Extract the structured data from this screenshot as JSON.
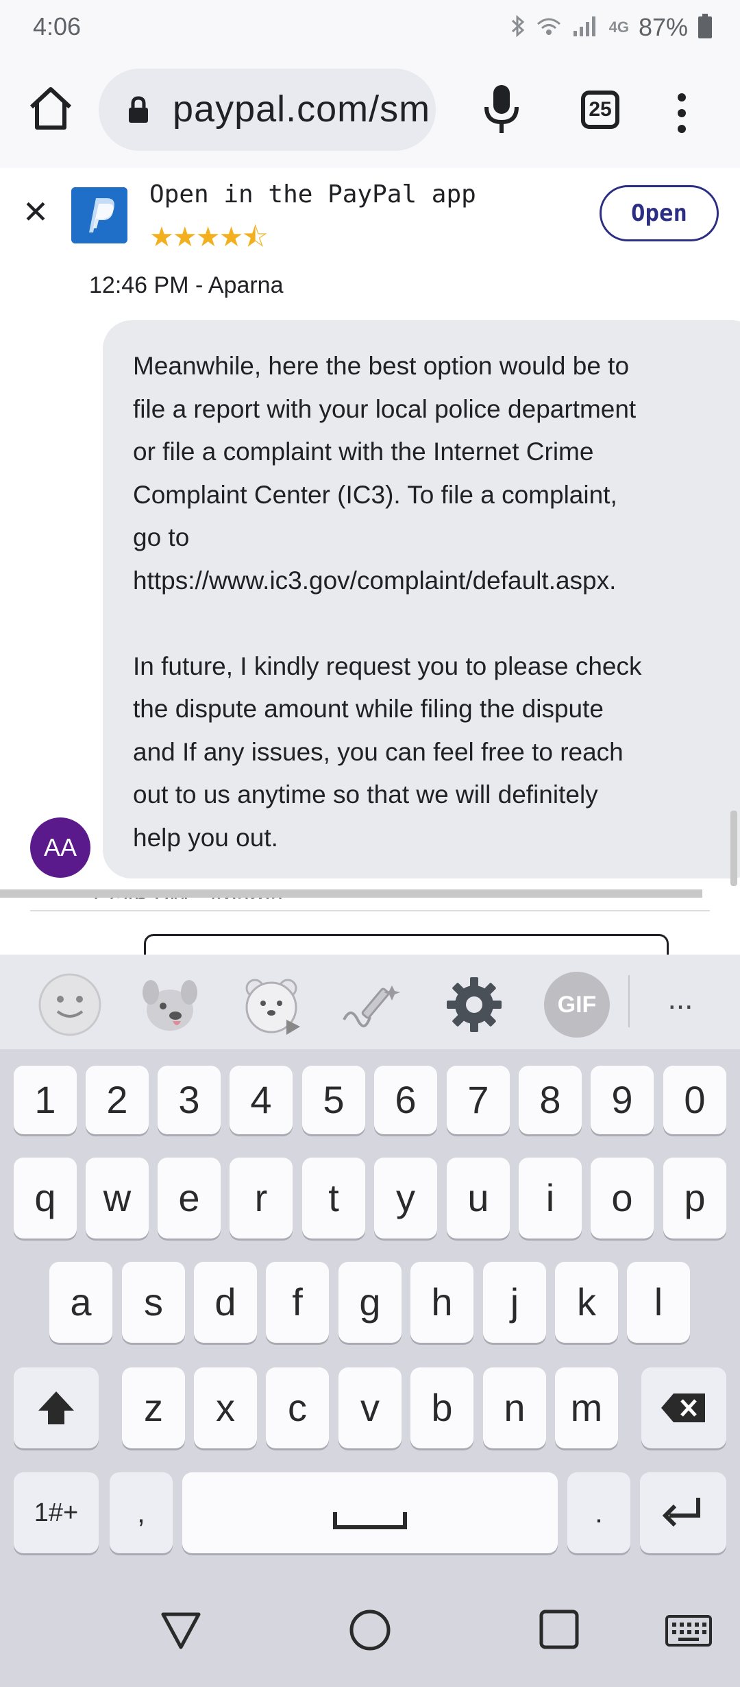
{
  "status_bar": {
    "time": "4:06",
    "network": "4G",
    "battery": "87%"
  },
  "browser": {
    "url": "paypal.com/sm",
    "tab_count": "25"
  },
  "app_banner": {
    "title": "Open in the PayPal app",
    "rating_stars": 4.5,
    "rating_display": "★★★★⯪",
    "open_label": "Open",
    "brand_color": "#2c2e83"
  },
  "chat": {
    "message_meta": "12:46 PM - Aparna",
    "message_text": "Meanwhile, here the best option would be to\nfile a report with your local police department\nor file a complaint with the Internet Crime\nComplaint Center (IC3). To file a complaint,\ngo to\nhttps://www.ic3.gov/complaint/default.aspx.\n\nIn future, I kindly request you to please check\nthe dispute amount while filing the dispute\nand If any issues, you can feel free to reach\nout to us anytime so that we will definitely\nhelp you out.",
    "avatar_initials": "AA",
    "avatar_color": "#5b1a8b",
    "next_meta": "12:46 PM - Aparna"
  },
  "keyboard": {
    "toolbar_icons": [
      "emoji-icon",
      "sticker-dog-icon",
      "bear-sticker-icon",
      "handwriting-icon",
      "settings-icon",
      "gif-icon",
      "more-icon"
    ],
    "gif_label": "GIF",
    "more_label": "...",
    "row_numbers": [
      "1",
      "2",
      "3",
      "4",
      "5",
      "6",
      "7",
      "8",
      "9",
      "0"
    ],
    "row_top": [
      "q",
      "w",
      "e",
      "r",
      "t",
      "y",
      "u",
      "i",
      "o",
      "p"
    ],
    "row_mid": [
      "a",
      "s",
      "d",
      "f",
      "g",
      "h",
      "j",
      "k",
      "l"
    ],
    "row_bot": [
      "z",
      "x",
      "c",
      "v",
      "b",
      "n",
      "m"
    ],
    "symbols_label": "1#+",
    "comma_label": ",",
    "period_label": "."
  }
}
